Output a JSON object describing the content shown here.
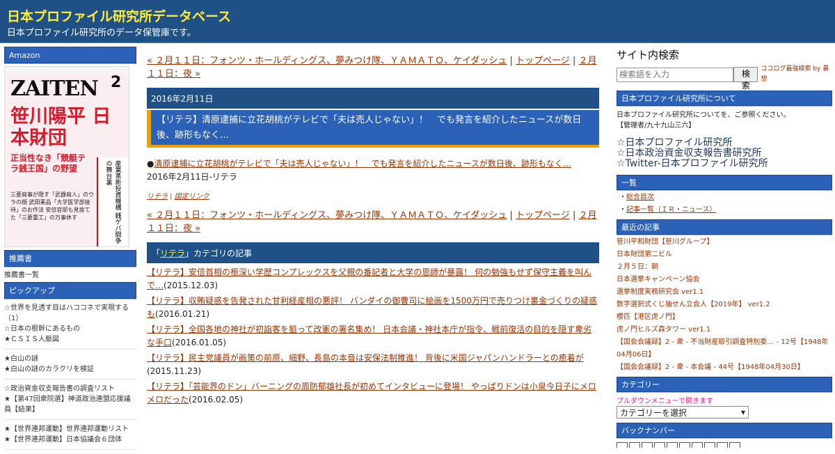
{
  "header": {
    "title": "日本プロファイル研究所データベース",
    "description": "日本プロファイル研究所のデータ保管庫です。"
  },
  "left": {
    "amazon_label": "Amazon",
    "book": {
      "magazine": "ZAITEN",
      "issue": "2",
      "headline": "笹川陽平 日本財団",
      "subhead": "正当性なき「競艇テラ銭王国」の野望",
      "side_text": "産業革新投資機構 銭ゲバ闘争の舞台裏",
      "lines": "三菱商事が隠す「武器商人」のウラの顔 武田薬品「大学医学部接待」のお作法 安倍官邸も見捨てた「三菱重工」の万事休す"
    },
    "recommend_label": "推薦書",
    "recommend_link": "推薦書一覧",
    "pickup_label": "ピックアップ",
    "pickup_groups": [
      [
        "☆世界を見透す目はハココネで実現する（1）",
        "☆日本の根幹にあるもの",
        "★ＣＳＩＳ人脈図"
      ],
      [
        "★白山の謎",
        "★白山の謎のカラクリを検証"
      ],
      [
        "☆政治資金収支報告書の調査リスト",
        "★【第47回衆院選】神道政治連盟応援議員【結果】"
      ],
      [
        "★【世界連邦運動】世界連邦運動リスト",
        "★【世界連邦運動】日本協議会６団体"
      ]
    ]
  },
  "main": {
    "pager_prev": "« ２月１１日：フォンツ・ホールディングス、夢みつけ隊、ＹＡＭＡＴＯ、ケイダッシュ",
    "pager_sep1": " | ",
    "pager_top": "トップページ",
    "pager_sep2": " | ",
    "pager_next": "２月１１日：夜 »",
    "date": "2016年2月11日",
    "entry_title": "【リテラ】清原逮捕に立花胡桃がテレビで「夫は売人じゃない」！　でも発言を紹介したニュースが数日後、跡形もなく…",
    "entry_bullet": "●",
    "entry_link": "清原逮捕に立花胡桃がテレビで「夫は売人じゃない」！　でも発言を紹介したニュースが数日後、跡形もなく…",
    "entry_meta": "2016年2月11日-リテラ",
    "foot_category": "リテラ",
    "foot_sep": " | ",
    "foot_permalink": "固定リンク",
    "cat_open": "「",
    "cat_name": "リテラ",
    "cat_close": "」カテゴリの記事",
    "related": [
      {
        "title": "【リテラ】安倍首相の根深い学歴コンプレックスを父親の番記者と大学の恩師が暴露！ 何の勉強もせず保守主義を叫んで…",
        "date": "(2015.12.03)"
      },
      {
        "title": "【リテラ】収賄疑惑を告発された甘利経産相の悪評！ バンダイの御曹司に絵画を1500万円で売りつけ裏金づくりの疑惑も",
        "date": "(2016.01.21)"
      },
      {
        "title": "【リテラ】全国各地の神社が初詣客を狙って改憲の署名集め！ 日本会議・神社本庁が指令、戦前復活の目的を隠す卑劣な手口",
        "date": "(2016.01.05)"
      },
      {
        "title": "【リテラ】民主党議員が画策の前原、細野、長島の本音は安保法制推進！ 背後に米国ジャパンハンドラーとの癒着が",
        "date": "(2015.11.23)"
      },
      {
        "title": "【リテラ】「芸能界のドン」バーニングの周防郁雄社長が初めてインタビューに登場！ やっぱりドンは小泉今日子にメロメロだった",
        "date": "(2016.02.05)"
      }
    ]
  },
  "right": {
    "search_heading": "サイト内検索",
    "search_placeholder": "検索語を入力",
    "search_button": "検索",
    "powered": "ココログ最強検索 by 暴想",
    "about_label": "日本プロファイル研究所について",
    "about_text": "日本プロファイル研究所についてを、ご参照ください。",
    "admin": "【管理者/九十九山三六】",
    "big_links": [
      "☆日本プロファイル研究所",
      "☆日本政治資金収支報告書研究所",
      "☆Twitter-日本プロファイル研究所"
    ],
    "list_label": "一覧",
    "list_items": [
      "総合目次",
      "記事一覧（ＩＲ・ニュース）"
    ],
    "recent_label": "最近の記事",
    "recent_items": [
      "笹川平和財団【笹川グループ】",
      "日本財団第二ビル",
      "２月５日：朝",
      "日本選挙キャンペーン協会",
      "選挙制度実務研究会 ver1.1",
      "数字選択式くじ抽せん立会人【2019年】 ver1.2",
      "櫻匹【港区虎ノ門】",
      "虎ノ門ヒルズ森タワー ver1.1",
      "【国会会議録】2 - 衆 - 不当財産取引調査特別委… - 12号【1948年04月06日】",
      "【国会会議録】2 - 衆 - 本会議 - 44号【1948年04月30日】"
    ],
    "category_label": "カテゴリー",
    "category_note": "プルダウンメニューで開きます",
    "category_select": "カテゴリーを選択",
    "backnumber_label": "バックナンバー"
  }
}
